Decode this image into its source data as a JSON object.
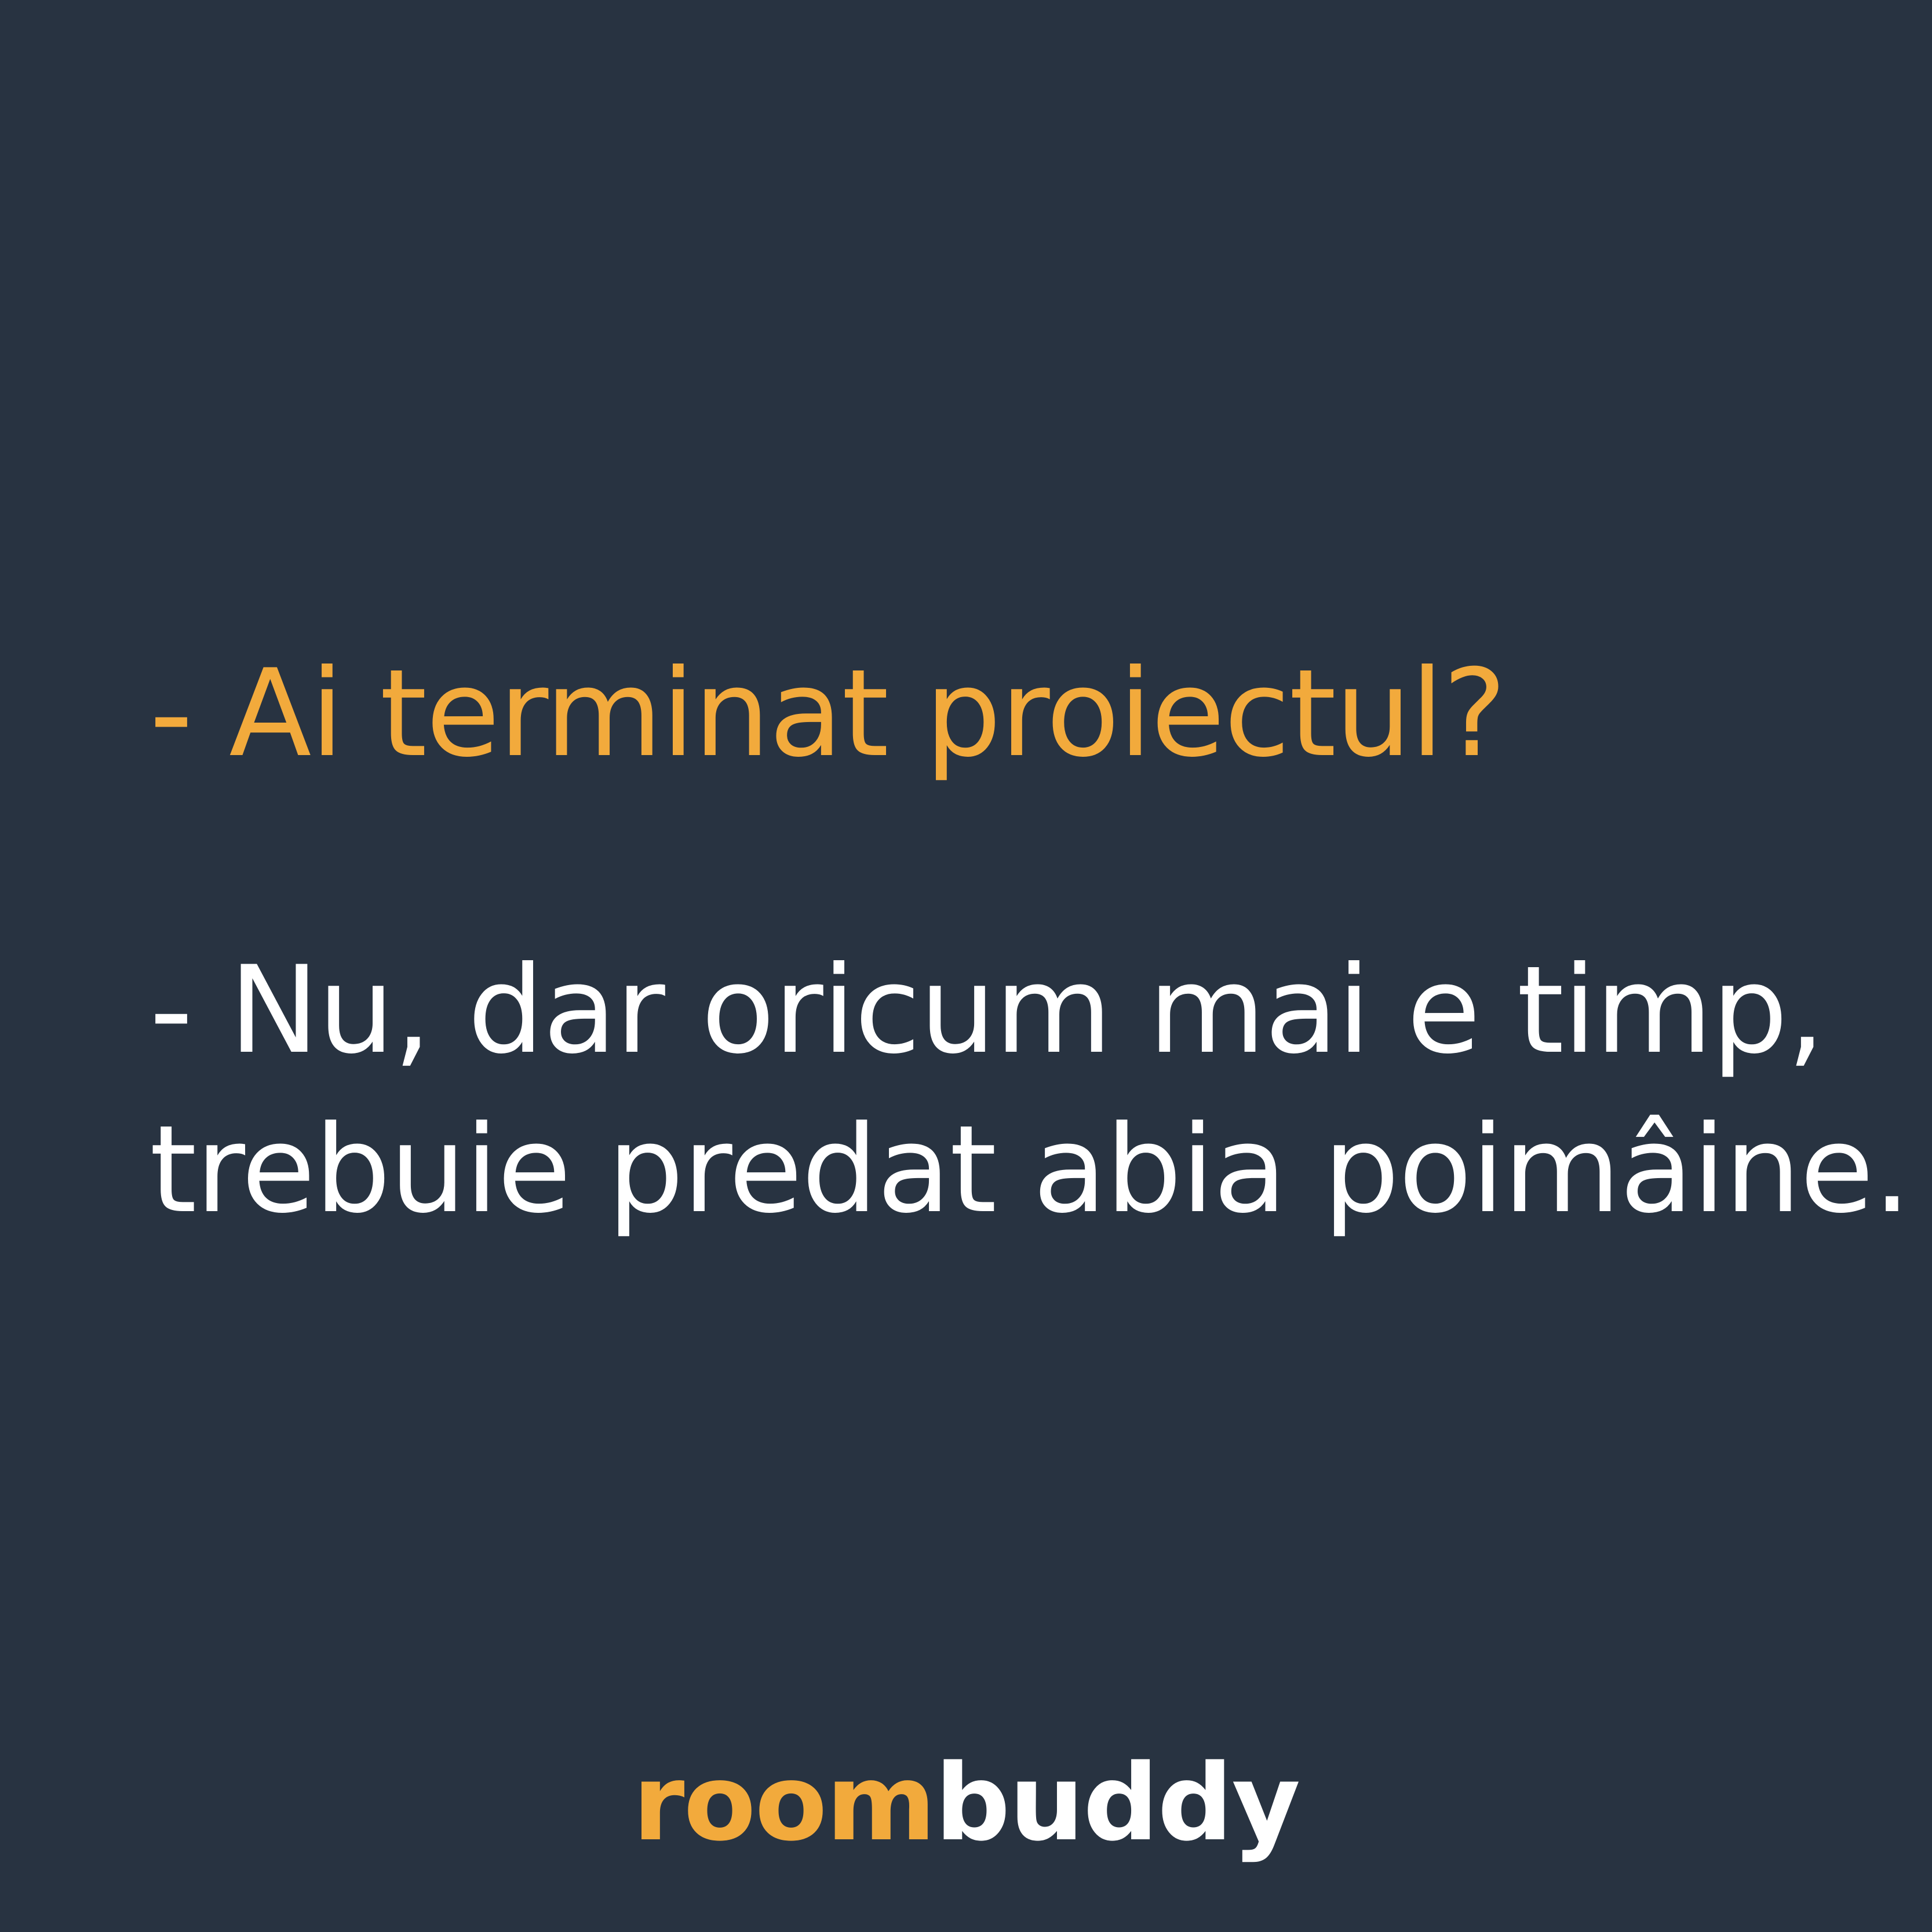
{
  "colors": {
    "background": "#283341",
    "accent": "#f2aa3c",
    "text": "#ffffff"
  },
  "dialogue": {
    "question": "- Ai terminat proiectul?",
    "answer_line_1": "- Nu, dar oricum mai e timp,",
    "answer_line_2": "trebuie predat abia poimâine."
  },
  "logo": {
    "part_1": "room",
    "part_2": "buddy"
  }
}
